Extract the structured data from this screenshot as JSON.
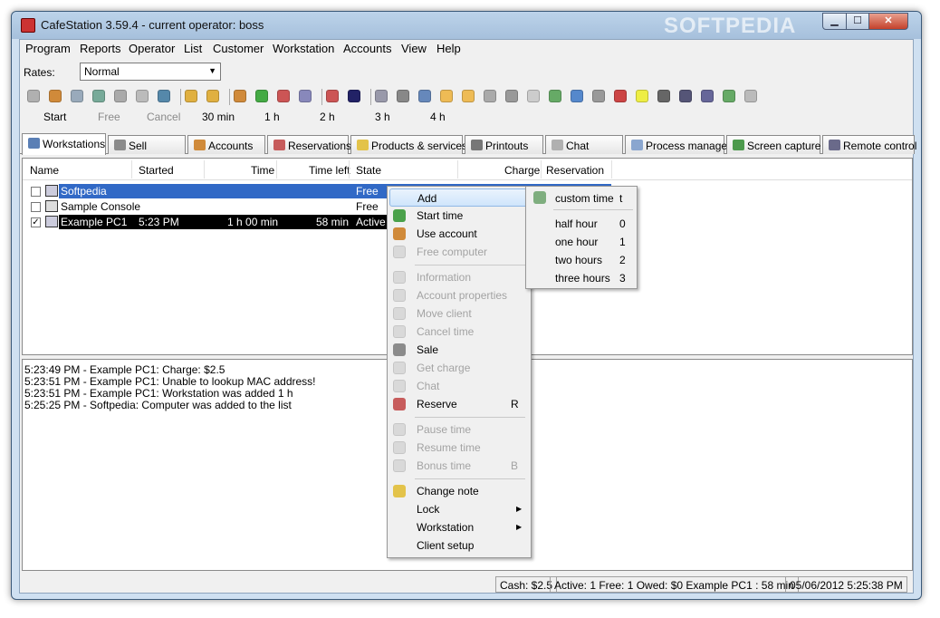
{
  "window": {
    "title": "CafeStation 3.59.4 - current operator: boss",
    "watermark": "SOFTPEDIA",
    "min": "▁",
    "max": "☐",
    "close": "✕"
  },
  "menu": [
    "Program",
    "Reports",
    "Operator",
    "List",
    "Customer",
    "Workstation",
    "Accounts",
    "View",
    "Help"
  ],
  "rates": {
    "label": "Rates:",
    "value": "Normal",
    "arrow": "▼"
  },
  "toolbar_icons": [
    "info-icon",
    "user-icon",
    "search-icon",
    "move-icon",
    "wrench-icon",
    "check-icon",
    "monitor-icon",
    "lock-icon",
    "unlock-icon",
    "account-icon",
    "money-icon",
    "chart-icon",
    "table-icon",
    "cubes-icon",
    "operator-icon",
    "computer-icon",
    "cart-icon",
    "mail-icon",
    "note-icon",
    "pencil-icon",
    "transfer-icon",
    "cart2-icon",
    "clock-icon",
    "timer-icon",
    "network-icon",
    "list-icon",
    "window-icon",
    "edit-icon",
    "printer-icon",
    "server-icon",
    "monitor2-icon",
    "arrow-icon",
    "key-icon"
  ],
  "quick": {
    "start": "Start",
    "free": "Free",
    "cancel": "Cancel",
    "m30": "30 min",
    "h1": "1 h",
    "h2": "2 h",
    "h3": "3 h",
    "h4": "4 h"
  },
  "tabs": [
    "Workstations",
    "Sell",
    "Accounts",
    "Reservations",
    "Products & services",
    "Printouts",
    "Chat",
    "Process manager",
    "Screen capture",
    "Remote control"
  ],
  "grid": {
    "headers": {
      "name": "Name",
      "started": "Started",
      "time": "Time",
      "time_left": "Time left",
      "state": "State",
      "charge": "Charge",
      "reservation": "Reservation"
    },
    "rows": [
      {
        "name": "Softpedia",
        "started": "",
        "time": "",
        "time_left": "",
        "state": "Free",
        "checked": "",
        "selected": true
      },
      {
        "name": "Sample Console",
        "started": "",
        "time": "",
        "time_left": "",
        "state": "Free",
        "checked": "",
        "selected": false
      },
      {
        "name": "Example PC1",
        "started": "5:23 PM",
        "time": "1 h 00 min",
        "time_left": "58 min",
        "state": "Active",
        "checked": "✓",
        "selected": false
      }
    ]
  },
  "log": [
    "5:23:49 PM - Example PC1: Charge: $2.5",
    "5:23:51 PM - Example PC1: Unable to lookup MAC address!",
    "5:23:51 PM - Example PC1: Workstation was added 1 h",
    "5:25:25 PM - Softpedia: Computer was added to the list"
  ],
  "status": {
    "cash": "Cash: $2.5",
    "summary": "Active: 1 Free: 1 Owed: $0 Example PC1 : 58 min",
    "datetime": "05/06/2012 5:25:38 PM"
  },
  "context_menu": {
    "add": "Add",
    "start_time": "Start time",
    "use_account": "Use account",
    "free_computer": "Free computer",
    "information": "Information",
    "account_properties": "Account properties",
    "move_client": "Move client",
    "cancel_time": "Cancel time",
    "sale": "Sale",
    "get_charge": "Get charge",
    "chat": "Chat",
    "reserve": "Reserve",
    "reserve_key": "R",
    "pause_time": "Pause time",
    "resume_time": "Resume time",
    "bonus_time": "Bonus time",
    "bonus_key": "B",
    "change_note": "Change note",
    "lock": "Lock",
    "workstation": "Workstation",
    "client_setup": "Client setup",
    "arrow": "▶"
  },
  "submenu": {
    "custom_time": "custom time",
    "custom_key": "t",
    "half_hour": "half hour",
    "half_key": "0",
    "one_hour": "one hour",
    "one_key": "1",
    "two_hours": "two hours",
    "two_key": "2",
    "three_hours": "three hours",
    "three_key": "3"
  },
  "colors": {
    "selection": "#3169c6",
    "title_bar": "#b3cbe5"
  }
}
